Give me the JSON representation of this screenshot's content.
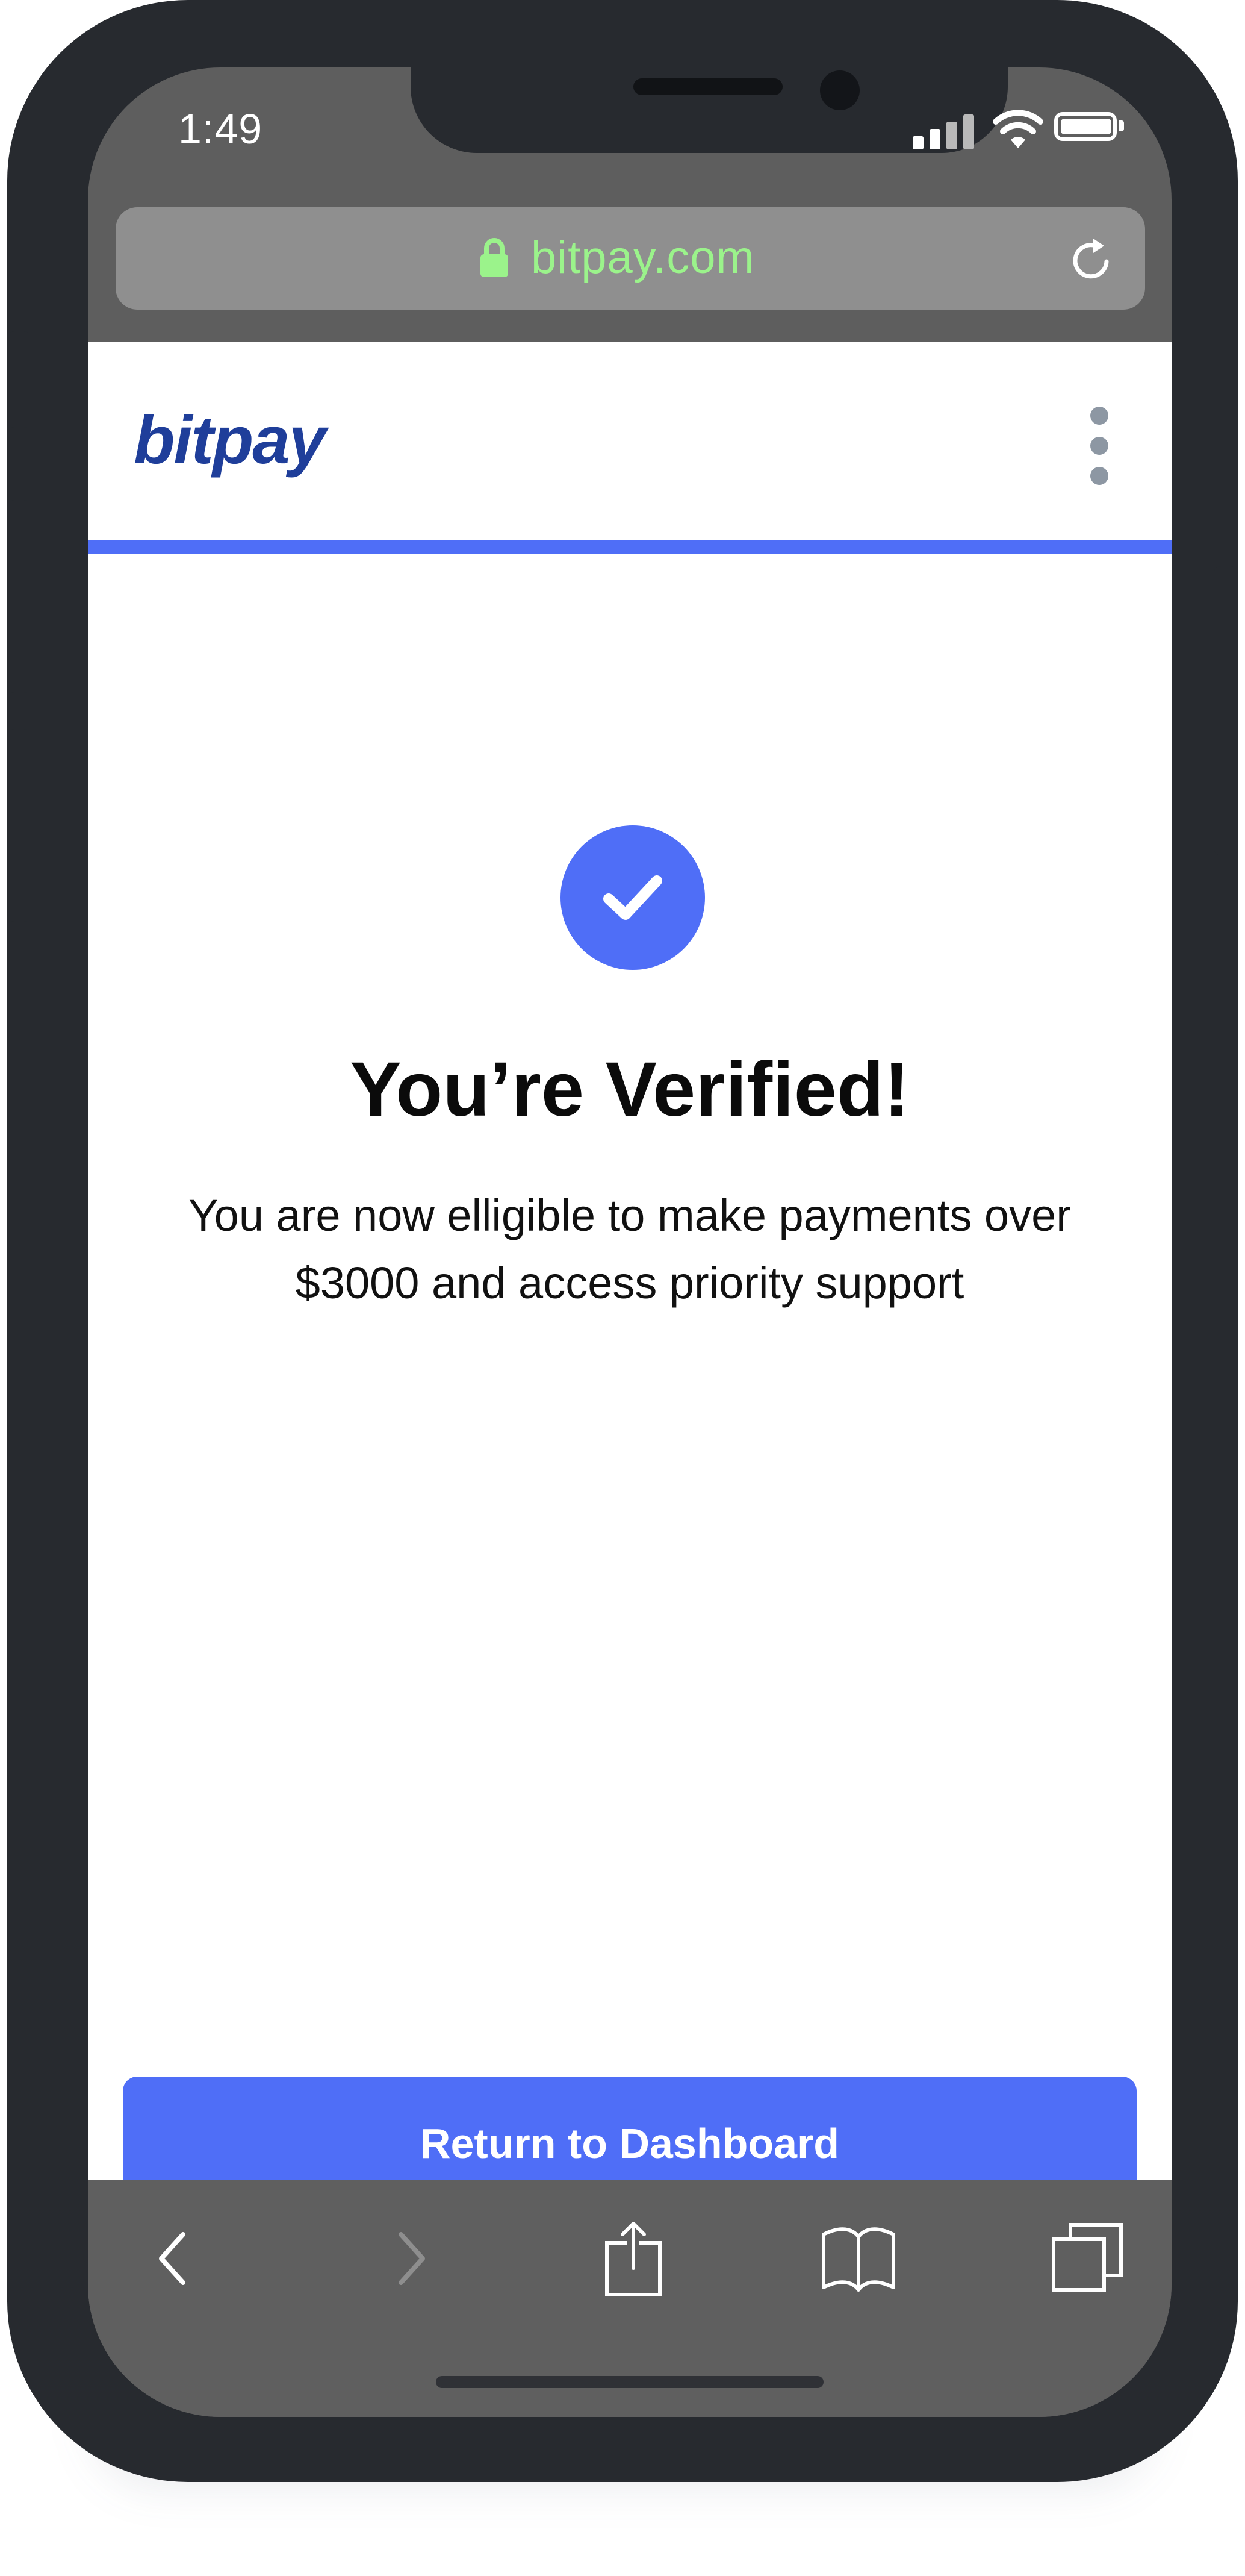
{
  "status_bar": {
    "time": "1:49"
  },
  "browser": {
    "url": "bitpay.com"
  },
  "site": {
    "brand": "bitpay"
  },
  "verification": {
    "title": "You’re Verified!",
    "message": "You are now elligible to make payments over\n$3000 and access priority support",
    "cta_label": "Return to Dashboard"
  },
  "icons": {
    "status": [
      "signal-icon",
      "wifi-icon",
      "battery-icon"
    ],
    "url": [
      "lock-icon",
      "reload-icon"
    ],
    "content": [
      "kebab-menu-icon",
      "checkmark-icon"
    ],
    "toolbar": [
      "back-icon",
      "forward-icon",
      "share-icon",
      "bookmarks-icon",
      "tabs-icon"
    ]
  },
  "progress": {
    "percent": 100
  },
  "colors": {
    "accent": "#4F6EF7",
    "brand": "#1F3E9A",
    "url_text": "#9BF38B",
    "frame": "#272A2F",
    "chrome": "#5E5E5E"
  }
}
